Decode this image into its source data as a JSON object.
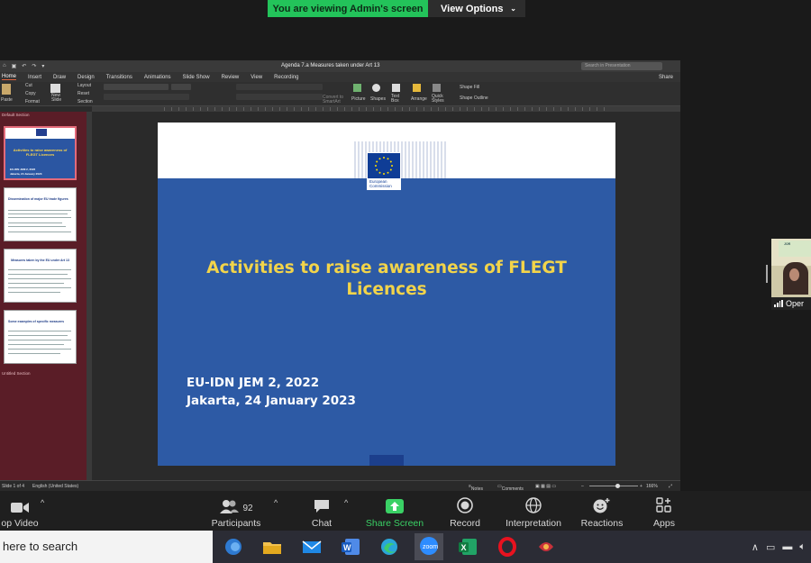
{
  "banner": {
    "status_text": "You are viewing Admin's screen",
    "view_options_label": "View Options"
  },
  "ppt": {
    "doc_title": "Agenda 7.a Measures taken under Art 13",
    "search_placeholder": "Search in Presentation",
    "tabs": [
      "Home",
      "Insert",
      "Draw",
      "Design",
      "Transitions",
      "Animations",
      "Slide Show",
      "Review",
      "View",
      "Recording"
    ],
    "share_label": "Share",
    "ribbon": {
      "paste": "Paste",
      "cut": "Cut",
      "copy": "Copy",
      "format": "Format",
      "new_slide": "New Slide",
      "layout": "Layout",
      "reset": "Reset",
      "section": "Section",
      "convert": "Convert to SmartArt",
      "picture": "Picture",
      "shapes": "Shapes",
      "text_box": "Text Box",
      "arrange": "Arrange",
      "quick_styles": "Quick Styles",
      "shape_fill": "Shape Fill",
      "shape_outline": "Shape Outline"
    },
    "section_default": "Default Section",
    "section_untitled": "Untitled Section",
    "thumbnails": [
      {
        "number": "1",
        "title": "Activities to raise awareness of FLEGT Licences",
        "sub1": "EU-IDN JEM 2, 2022",
        "sub2": "Jakarta, 24 January 2023"
      },
      {
        "number": "2",
        "title": "Dissemination of major EU trade figures"
      },
      {
        "number": "3",
        "title": "Measures taken by the EU under Art 13"
      },
      {
        "number": "4",
        "title": "Some examples of specific measures"
      }
    ],
    "slide": {
      "logo_text_1": "European",
      "logo_text_2": "Commission",
      "title_line1": "Activities to raise awareness of FLEGT",
      "title_line2": "Licences",
      "sub_line1": "EU-IDN JEM 2, 2022",
      "sub_line2": "Jakarta, 24 January 2023"
    },
    "status": {
      "slide_count": "Slide 1 of 4",
      "language": "English (United States)",
      "notes": "Notes",
      "comments": "Comments",
      "zoom": "166%"
    }
  },
  "participant_tile": {
    "name": "Oper"
  },
  "toolbar": {
    "stop_video": "op Video",
    "participants": "Participants",
    "participants_count": "92",
    "chat": "Chat",
    "share_screen": "Share Screen",
    "record": "Record",
    "interpretation": "Interpretation",
    "reactions": "Reactions",
    "apps": "Apps"
  },
  "taskbar": {
    "search_text": "here to search",
    "apps": [
      "outlook",
      "file-explorer",
      "mail",
      "word",
      "edge",
      "zoom",
      "excel",
      "opera",
      "paint"
    ],
    "zoom_label": "zoom"
  },
  "colors": {
    "accent_green": "#3ad165",
    "slide_blue": "#2d5aa5",
    "slide_title_yellow": "#f2d44a",
    "thumb_pane": "#5a1d27"
  }
}
